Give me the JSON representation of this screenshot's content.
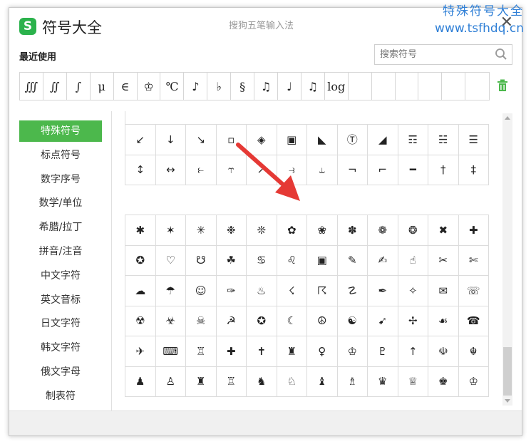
{
  "window": {
    "logo_glyph": "S",
    "title": "符号大全",
    "ime_title": "搜狗五笔输入法",
    "close_glyph": "✕"
  },
  "watermark": {
    "line1": "特殊符号大全",
    "line2": "www.tsfhdq.cn"
  },
  "recent": {
    "label": "最近使用",
    "symbols": [
      "∭",
      "∬",
      "∫",
      "μ",
      "∈",
      "♔",
      "℃",
      "♪",
      "♭",
      "§",
      "♫",
      "♩",
      "♫",
      "log",
      "",
      "",
      "",
      "",
      "",
      ""
    ]
  },
  "search": {
    "placeholder": "搜索符号"
  },
  "sidebar": {
    "items": [
      {
        "label": "特殊符号"
      },
      {
        "label": "标点符号"
      },
      {
        "label": "数字序号"
      },
      {
        "label": "数学/单位"
      },
      {
        "label": "希腊/拉丁"
      },
      {
        "label": "拼音/注音"
      },
      {
        "label": "中文字符"
      },
      {
        "label": "英文音标"
      },
      {
        "label": "日文字符"
      },
      {
        "label": "韩文字符"
      },
      {
        "label": "俄文字母"
      },
      {
        "label": "制表符"
      }
    ],
    "active_index": 0
  },
  "grid_a": [
    [
      "↙",
      "↓",
      "↘",
      "▫",
      "◈",
      "▣",
      "◣",
      "Ⓣ",
      "◢",
      "☶",
      "☵",
      "☰"
    ],
    [
      "↕",
      "↔",
      "⥼",
      "⥾",
      "↗",
      "⥽",
      "⥿",
      "¬",
      "⌐",
      "━",
      "†",
      "‡"
    ]
  ],
  "grid_b": [
    [
      "✱",
      "✶",
      "✳",
      "❉",
      "❊",
      "✿",
      "❀",
      "✽",
      "❁",
      "❂",
      "✖",
      "✚"
    ],
    [
      "✪",
      "♡",
      "☋",
      "☘",
      "♋",
      "♌",
      "▣",
      "✎",
      "✍",
      "☝",
      "✂",
      "✄"
    ],
    [
      "☁",
      "☂",
      "☺",
      "✑",
      "♨",
      "☇",
      "☈",
      "☡",
      "✒",
      "✧",
      "✉",
      "☏"
    ],
    [
      "☢",
      "☣",
      "☠",
      "☭",
      "✪",
      "☾",
      "☮",
      "☯",
      "➹",
      "✢",
      "☙",
      "☎"
    ],
    [
      "✈",
      "⌨",
      "♖",
      "✚",
      "✝",
      "♜",
      "♀",
      "♔",
      "♇",
      "↑",
      "☫",
      "☬"
    ],
    [
      "♟",
      "♙",
      "♜",
      "♖",
      "♞",
      "♘",
      "♝",
      "♗",
      "♛",
      "♕",
      "♚",
      "♔"
    ]
  ],
  "colors": {
    "accent": "#4cb84c",
    "logo": "#2bb24c",
    "arrow": "#e53935",
    "watermark": "#2f7fd6"
  }
}
